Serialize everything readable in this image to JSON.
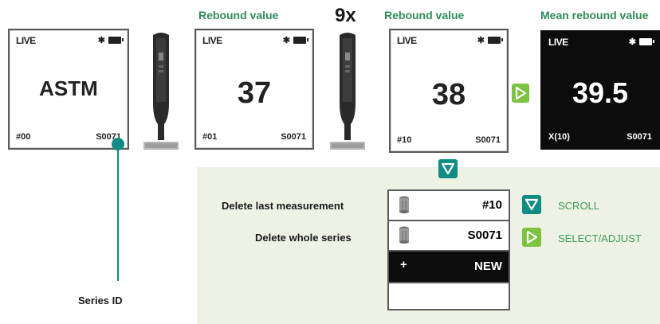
{
  "headers": {
    "rebound_1": "Rebound value",
    "multiplier": "9x",
    "rebound_2": "Rebound value",
    "mean": "Mean rebound value"
  },
  "screens": [
    {
      "live": "LIVE",
      "value": "ASTM",
      "left": "#00",
      "right": "S0071"
    },
    {
      "live": "LIVE",
      "value": "37",
      "left": "#01",
      "right": "S0071"
    },
    {
      "live": "LIVE",
      "value": "38",
      "left": "#10",
      "right": "S0071"
    },
    {
      "live": "LIVE",
      "value": "39.5",
      "left": "X(10)",
      "right": "S0071"
    }
  ],
  "menu": {
    "delete_last_label": "Delete last measurement",
    "delete_series_label": "Delete whole series",
    "row1_value": "#10",
    "row2_value": "S0071",
    "row3_value": "NEW",
    "row3_prefix": "+"
  },
  "legend": {
    "scroll": "SCROLL",
    "select": "SELECT/ADJUST"
  },
  "series_id_label": "Series ID",
  "colors": {
    "teal": "#0f8c84",
    "green": "#7dc241",
    "header_green": "#2e8b57",
    "panel_bg": "#eef2e5"
  },
  "icons": [
    "bluetooth-icon",
    "battery-icon",
    "trash-can-icon",
    "down-arrow-icon",
    "right-arrow-icon",
    "plus-icon",
    "rebound-hammer-icon"
  ]
}
